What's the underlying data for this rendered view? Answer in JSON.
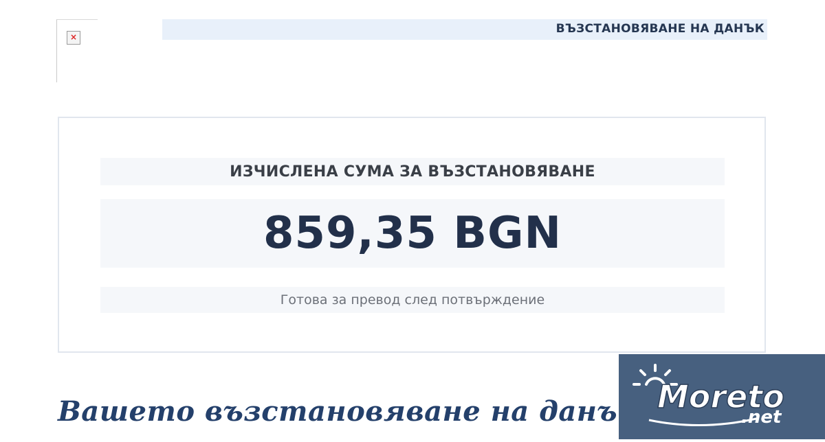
{
  "header": {
    "title": "ВЪЗСТАНОВЯВАНЕ НА ДАНЪК"
  },
  "card": {
    "label": "ИЗЧИСЛЕНА СУМА ЗА ВЪЗСТАНОВЯВАНЕ",
    "amount": "859,35 BGN",
    "status": "Готова за превод след потвърждение"
  },
  "headline": "Вашето възстановяване на данък е",
  "watermark": {
    "text": "Moreto.net",
    "icon": "sun-icon"
  },
  "colors": {
    "header_band": "#e8f0fa",
    "heading_dark": "#22304a",
    "headline_blue": "#24406b",
    "watermark_bg": "#47607f"
  }
}
